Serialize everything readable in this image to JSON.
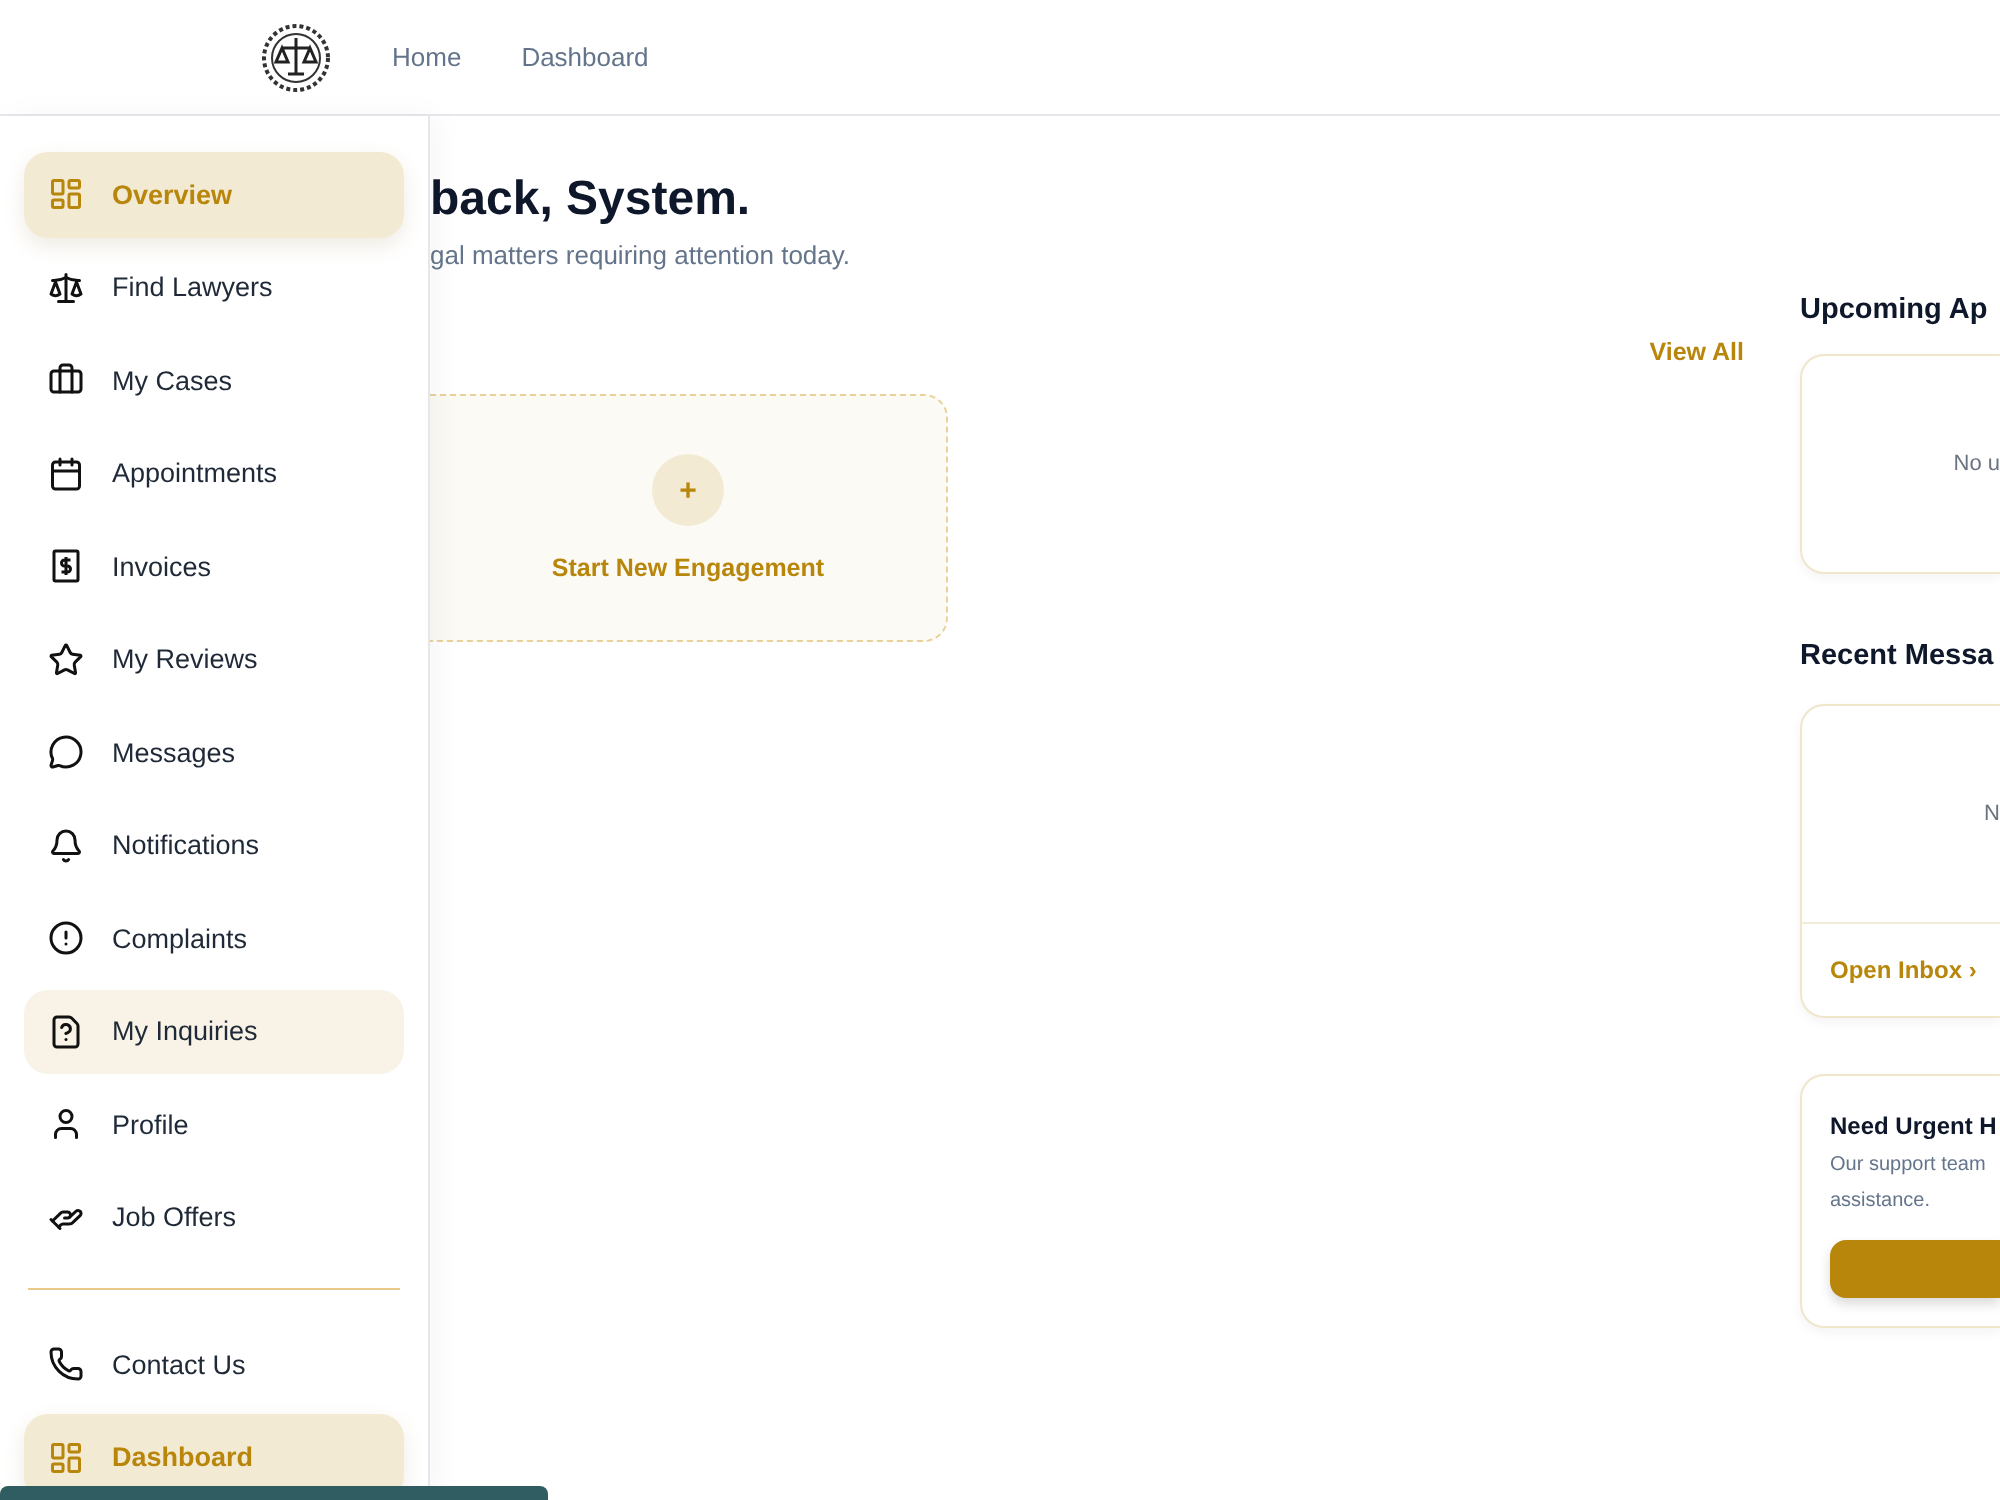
{
  "nav": {
    "links": [
      {
        "label": "Home"
      },
      {
        "label": "Dashboard"
      }
    ]
  },
  "sidebar": {
    "items": [
      {
        "label": "Overview",
        "selected": true,
        "hovered": false
      },
      {
        "label": "Find Lawyers",
        "selected": false,
        "hovered": false
      },
      {
        "label": "My Cases",
        "selected": false,
        "hovered": false
      },
      {
        "label": "Appointments",
        "selected": false,
        "hovered": false
      },
      {
        "label": "Invoices",
        "selected": false,
        "hovered": false
      },
      {
        "label": "My Reviews",
        "selected": false,
        "hovered": false
      },
      {
        "label": "Messages",
        "selected": false,
        "hovered": false
      },
      {
        "label": "Notifications",
        "selected": false,
        "hovered": false
      },
      {
        "label": "Complaints",
        "selected": false,
        "hovered": false
      },
      {
        "label": "My Inquiries",
        "selected": false,
        "hovered": true
      },
      {
        "label": "Profile",
        "selected": false,
        "hovered": false
      },
      {
        "label": "Job Offers",
        "selected": false,
        "hovered": false
      }
    ],
    "footer_items": [
      {
        "label": "Contact Us",
        "selected": false,
        "hovered": false
      },
      {
        "label": "Dashboard",
        "selected": true,
        "hovered": false
      }
    ]
  },
  "main": {
    "greeting": "back, System.",
    "subtitle": "gal matters requiring attention today.",
    "view_all": "View All",
    "new_engagement": {
      "icon_text": "+",
      "label": "Start New Engagement"
    }
  },
  "right": {
    "appointments": {
      "title": "Upcoming Ap",
      "empty": "No u"
    },
    "messages": {
      "title": "Recent Messa",
      "empty": "N",
      "link": "Open Inbox",
      "link_arrow": "›"
    },
    "help": {
      "title": "Need Urgent H",
      "text": "Our support team",
      "text_2": "assistance."
    }
  }
}
